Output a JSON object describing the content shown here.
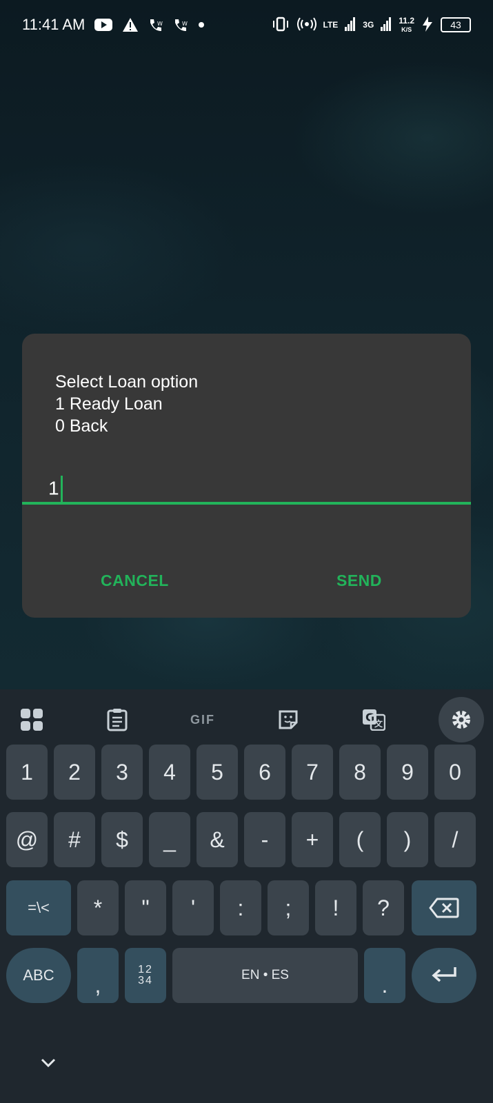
{
  "status_bar": {
    "time": "11:41 AM",
    "network_lte": "LTE",
    "network_3g": "3G",
    "speed_value": "11.2",
    "speed_unit": "K/S",
    "battery": "43",
    "icons": [
      "youtube-icon",
      "warning-icon",
      "wifi-call-icon",
      "wifi-call-icon",
      "dot-icon",
      "vibrate-icon",
      "hotspot-icon",
      "signal-icon",
      "charging-icon"
    ]
  },
  "dialog": {
    "message_lines": [
      "Select Loan option",
      "1 Ready Loan",
      "0 Back"
    ],
    "input_value": "1",
    "cancel_label": "CANCEL",
    "send_label": "SEND",
    "accent_color": "#22b35a"
  },
  "keyboard": {
    "toolbar": {
      "gif_label": "GIF",
      "icons": [
        "apps-grid-icon",
        "clipboard-icon",
        "gif-icon",
        "sticker-icon",
        "translate-icon",
        "gear-icon"
      ]
    },
    "row1": [
      "1",
      "2",
      "3",
      "4",
      "5",
      "6",
      "7",
      "8",
      "9",
      "0"
    ],
    "row2": [
      "@",
      "#",
      "$",
      "_",
      "&",
      "-",
      "+",
      "(",
      ")",
      "/"
    ],
    "row3": [
      "=\\<",
      "*",
      "\"",
      "'",
      ":",
      ";",
      "!",
      "?"
    ],
    "row4": {
      "abc": "ABC",
      "comma": ",",
      "numpad_top": "12",
      "numpad_bottom": "34",
      "space": "EN • ES",
      "period": "."
    }
  }
}
